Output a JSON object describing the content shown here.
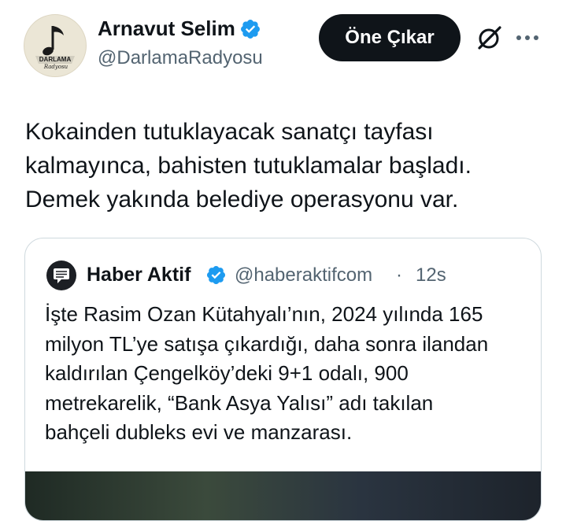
{
  "post": {
    "author": {
      "name": "Arnavut Selim",
      "handle": "@DarlamaRadyosu",
      "avatar_logo_text": "DARLAMA",
      "avatar_script_text": "Radyosu",
      "verified": true,
      "verified_color": "#1d9bf0"
    },
    "actions": {
      "feature_label": "Öne Çıkar",
      "grok_icon": "grok-icon",
      "more_icon": "more-horizontal-icon"
    },
    "text": "Kokainden tutuklayacak sanatçı tayfası\nkalmayınca, bahisten tutuklamalar başladı.\nDemek yakında belediye operasyonu var.",
    "quote": {
      "author_name": "Haber Aktif",
      "handle": "@haberaktifcom",
      "separator": "·",
      "time": "12s",
      "verified": true,
      "text": "İşte Rasim Ozan Kütahyalı’nın, 2024 yılında 165\nmilyon TL’ye satışa çıkardığı, daha sonra ilandan\nkaldırılan Çengelköy’deki 9+1 odalı, 900\nmetrekarelik, “Bank Asya Yalısı” adı takılan\nbahçeli dubleks evi ve manzarası."
    }
  },
  "colors": {
    "text_primary": "#0f1419",
    "text_secondary": "#536471",
    "border": "#cfd9de",
    "verified": "#1d9bf0",
    "button_bg": "#0f1419"
  }
}
